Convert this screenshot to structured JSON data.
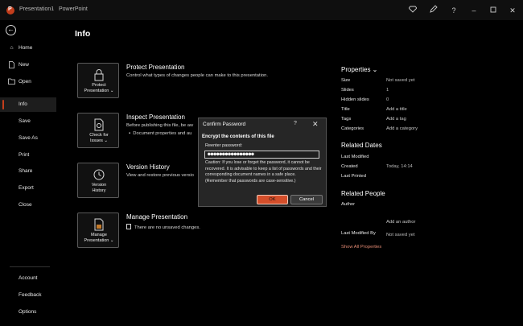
{
  "titlebar": {
    "doc_name": "Presentation1",
    "separator": "-",
    "app_name": "PowerPoint",
    "icons": [
      "diamond-icon",
      "pen-icon",
      "help-icon",
      "minimize-icon",
      "maximize-icon",
      "close-icon"
    ]
  },
  "sidebar": {
    "items": [
      {
        "label": "Home",
        "icon": "home-icon"
      },
      {
        "label": "New",
        "icon": "new-file-icon"
      },
      {
        "label": "Open",
        "icon": "open-folder-icon"
      },
      {
        "label": "Info"
      },
      {
        "label": "Save"
      },
      {
        "label": "Save As"
      },
      {
        "label": "Print"
      },
      {
        "label": "Share"
      },
      {
        "label": "Export"
      },
      {
        "label": "Close"
      }
    ],
    "bottom_items": [
      {
        "label": "Account"
      },
      {
        "label": "Feedback"
      },
      {
        "label": "Options"
      }
    ],
    "active": "Info",
    "accent_color": "#c43e1c"
  },
  "main": {
    "title": "Info",
    "sections": [
      {
        "tile_label_1": "Protect",
        "tile_label_2": "Presentation ⌄",
        "title": "Protect Presentation",
        "desc": "Control what types of changes people can make to this presentation."
      },
      {
        "tile_label_1": "Check for",
        "tile_label_2": "Issues ⌄",
        "title": "Inspect Presentation",
        "desc": "Before publishing this file, be aw",
        "bullet": "Document properties and au"
      },
      {
        "tile_label_1": "Version",
        "tile_label_2": "History",
        "title": "Version History",
        "desc": "View and restore previous versio"
      },
      {
        "tile_label_1": "Manage",
        "tile_label_2": "Presentation ⌄",
        "title": "Manage Presentation",
        "desc": "There are no unsaved changes."
      }
    ]
  },
  "properties": {
    "heading": "Properties ⌄",
    "rows": [
      {
        "key": "Size",
        "value": "Not saved yet"
      },
      {
        "key": "Slides",
        "value": "1"
      },
      {
        "key": "Hidden slides",
        "value": "0"
      },
      {
        "key": "Title",
        "value": "Add a title"
      },
      {
        "key": "Tags",
        "value": "Add a tag"
      },
      {
        "key": "Categories",
        "value": "Add a category"
      }
    ],
    "related_dates_heading": "Related Dates",
    "dates": [
      {
        "key": "Last Modified",
        "value": ""
      },
      {
        "key": "Created",
        "value": "Today, 14:14"
      },
      {
        "key": "Last Printed",
        "value": ""
      }
    ],
    "related_people_heading": "Related People",
    "author_key": "Author",
    "add_author": "Add an author",
    "last_modified_by_key": "Last Modified By",
    "last_modified_by_value": "Not saved yet",
    "show_all": "Show All Properties"
  },
  "dialog": {
    "title": "Confirm Password",
    "help": "?",
    "close": "✕",
    "heading": "Encrypt the contents of this file",
    "label": "Reenter password:",
    "password_value": "●●●●●●●●●●●●●●●●",
    "caution": "Caution: If you lose or forget the password, it cannot be recovered. It is advisable to keep a list of passwords and their corresponding document names in a safe place.",
    "caution_note": "(Remember that passwords are case-sensitive.)",
    "ok_label": "OK",
    "cancel_label": "Cancel"
  }
}
